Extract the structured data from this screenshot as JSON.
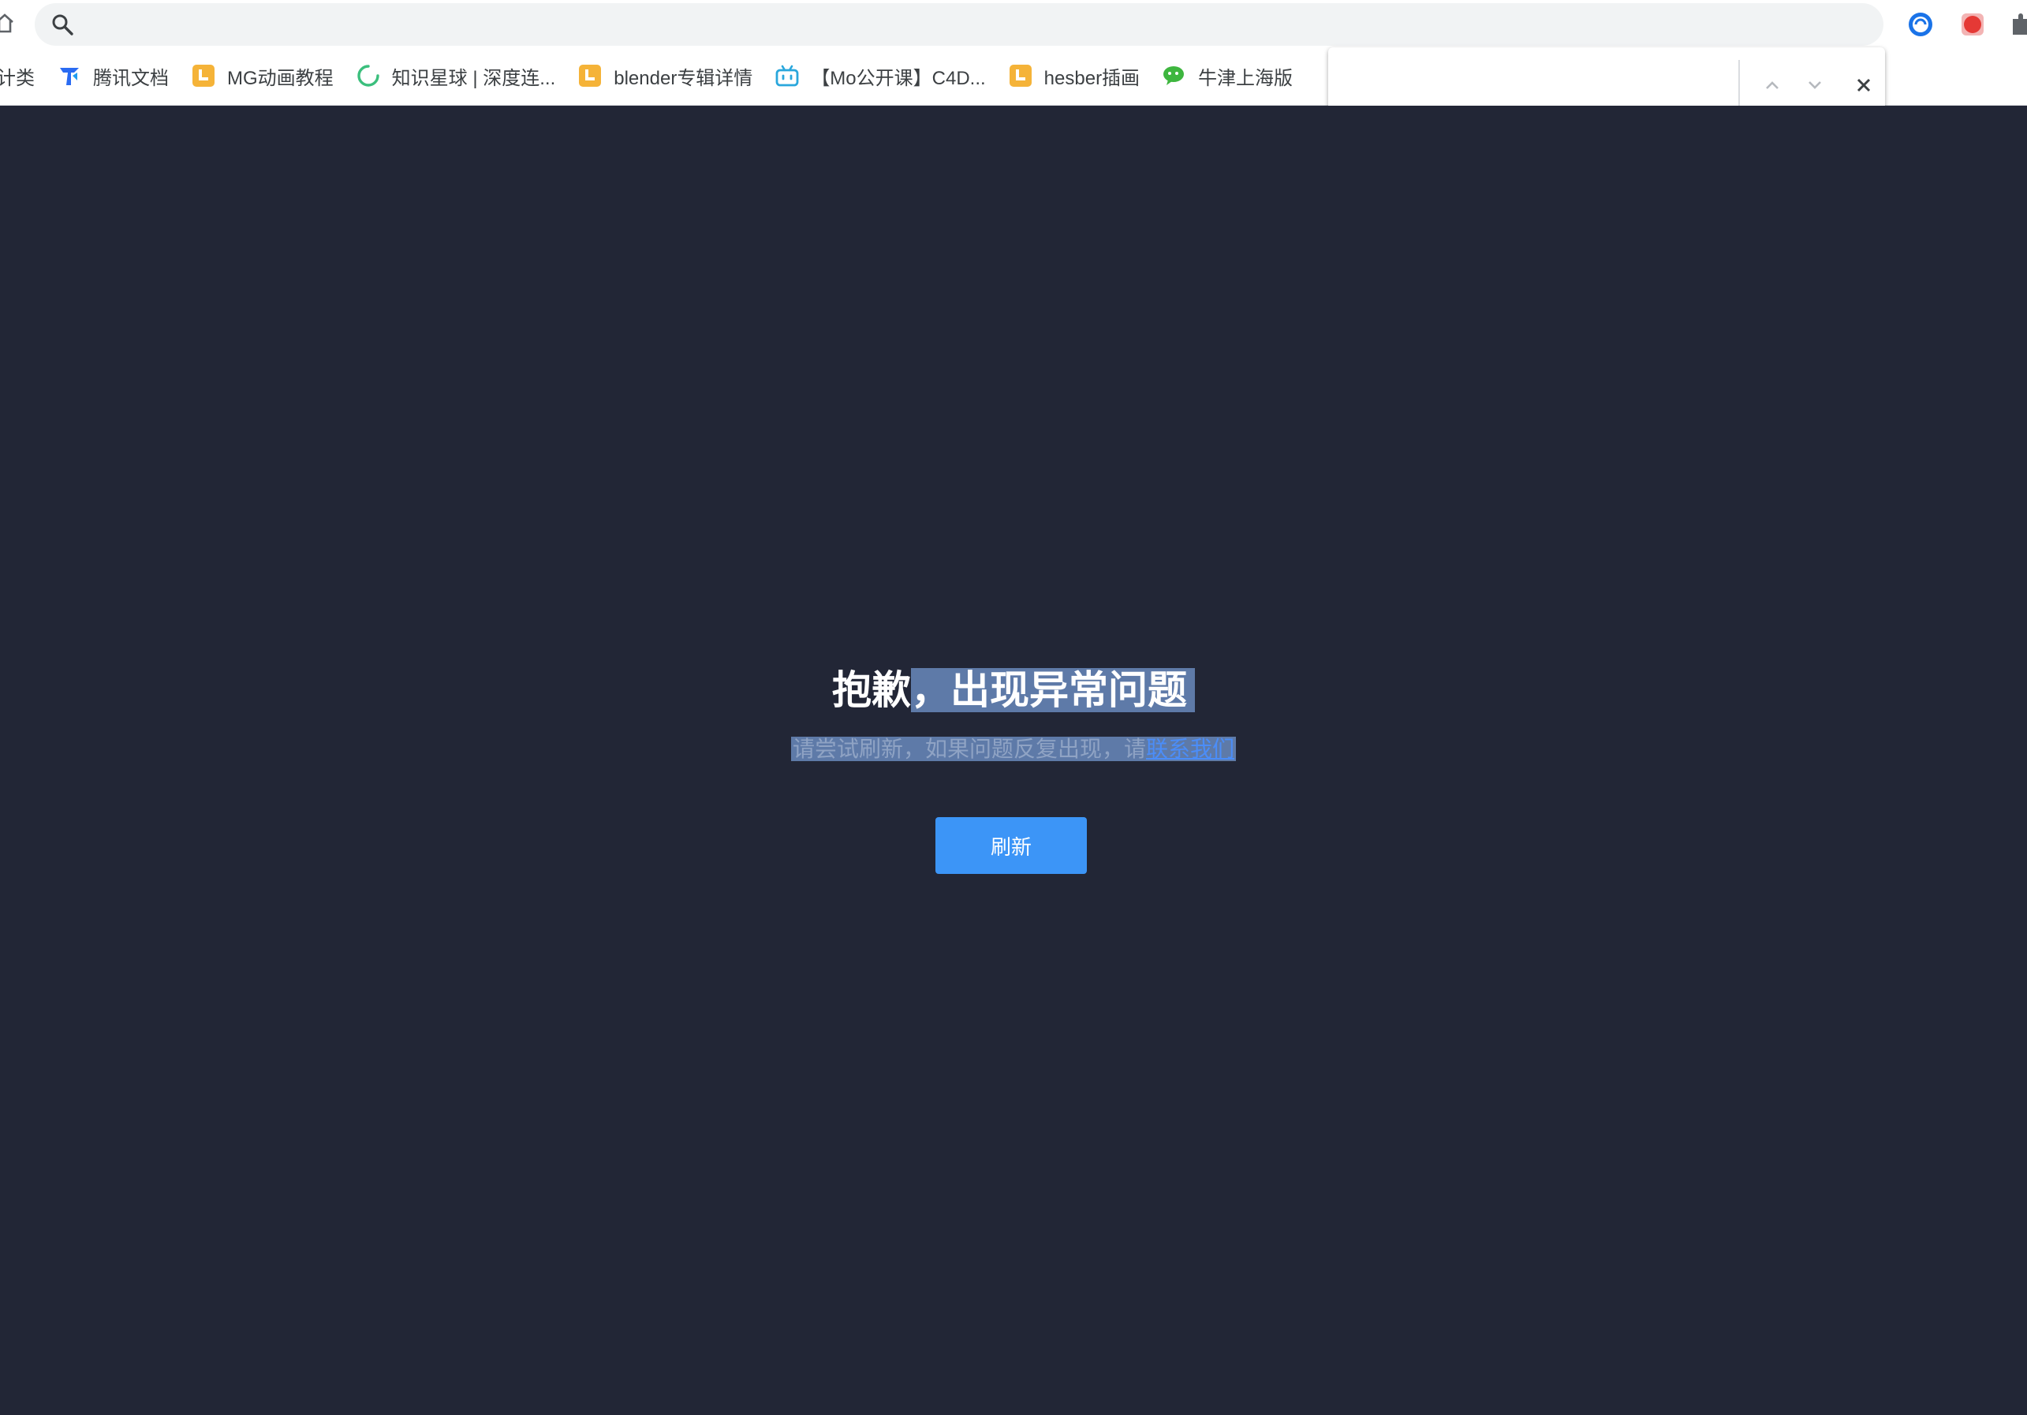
{
  "browser": {
    "address": {
      "value": "",
      "placeholder": ""
    },
    "bookmarks": [
      {
        "label": "计类",
        "icon": "folder-icon"
      },
      {
        "label": "腾讯文档",
        "icon": "tencent-docs-icon"
      },
      {
        "label": "MG动画教程",
        "icon": "bookmark-doc-icon"
      },
      {
        "label": "知识星球 | 深度连...",
        "icon": "zsxq-icon"
      },
      {
        "label": "blender专辑详情",
        "icon": "bookmark-doc-icon"
      },
      {
        "label": "【Mo公开课】C4D...",
        "icon": "bilibili-icon"
      },
      {
        "label": "hesber插画",
        "icon": "bookmark-doc-icon"
      },
      {
        "label": "牛津上海版",
        "icon": "wechat-icon"
      }
    ],
    "find": {
      "value": "",
      "placeholder": ""
    },
    "colors": {
      "chrome": "#ffffff",
      "address_bar": "#f1f3f4"
    }
  },
  "page": {
    "error_title_part1": "抱歉",
    "error_title_part2": "，出现异常问题",
    "error_desc": "请尝试刷新，如果问题反复出现，请",
    "contact_link": "联系我们",
    "refresh_label": "刷新",
    "colors": {
      "background": "#222636",
      "primary_button": "#3c95f7",
      "link": "#4b8df8",
      "selection": "#5e7aa8"
    }
  }
}
